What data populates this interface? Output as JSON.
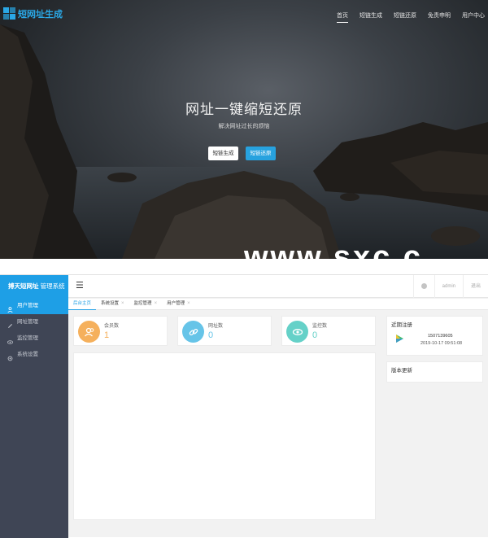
{
  "site": {
    "logo_text": "短网址生成",
    "nav": [
      "首页",
      "短链生成",
      "短链还原",
      "免责申明",
      "用户中心"
    ],
    "hero_title": "网址一键缩短还原",
    "hero_subtitle": "解决网址过长的烦恼",
    "btn_generate": "短链生成",
    "btn_restore": "短链还原",
    "watermark": "www.sxc.c"
  },
  "admin": {
    "brand_bold": "搏天短网址",
    "brand_rest": "管理系统",
    "menu": [
      "用户管理",
      "网址管理",
      "监控管理",
      "系统设置"
    ],
    "user": "admin",
    "logout": "退出",
    "tabs": [
      "后台主页",
      "系统设置",
      "监控管理",
      "用户管理"
    ],
    "stats": [
      {
        "label": "会员数",
        "value": "1",
        "color": "#f5b05c",
        "icon": "users-icon"
      },
      {
        "label": "网址数",
        "value": "0",
        "color": "#66c4e8",
        "icon": "link-icon"
      },
      {
        "label": "监控数",
        "value": "0",
        "color": "#65d1c8",
        "icon": "eye-icon"
      }
    ],
    "recent_title": "近期注册",
    "recent": {
      "phone": "1507139605",
      "time": "2019-10-17 09:51:08"
    },
    "version_title": "版本更新"
  }
}
